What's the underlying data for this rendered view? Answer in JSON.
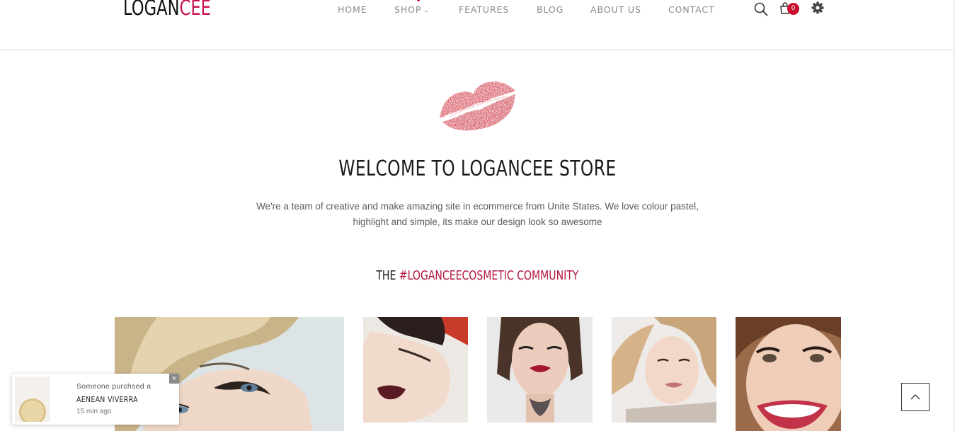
{
  "header": {
    "logo_main": "LOGAN",
    "logo_accent": "CEE",
    "nav": [
      {
        "label": "HOME"
      },
      {
        "label": "SHOP",
        "chevron": "⌄"
      },
      {
        "label": "FEATURES"
      },
      {
        "label": "BLOG"
      },
      {
        "label": "ABOUT US"
      },
      {
        "label": "CONTACT"
      }
    ],
    "icons": [
      "search-icon",
      "cart-icon",
      "gear-icon"
    ],
    "cart_count": "0"
  },
  "welcome": {
    "title": "WELCOME TO LOGANCEE STORE",
    "text_line1": "We're a team of creative and make amazing site in ecommerce from Unite States. We love colour pastel,",
    "text_line2": "highlight and simple, its make our design look so awesome"
  },
  "community": {
    "prefix": "THE ",
    "hashtag": "#LOGANCEECOSMETIC COMMUNITY"
  },
  "notification": {
    "line1": "Someone purchsed a",
    "product": "AENEAN VIVERRA",
    "time": "15 min ago",
    "close": "×"
  },
  "colors": {
    "accent": "#c8174f",
    "badge": "#c8102e",
    "nav_text": "#8a8a8a"
  }
}
